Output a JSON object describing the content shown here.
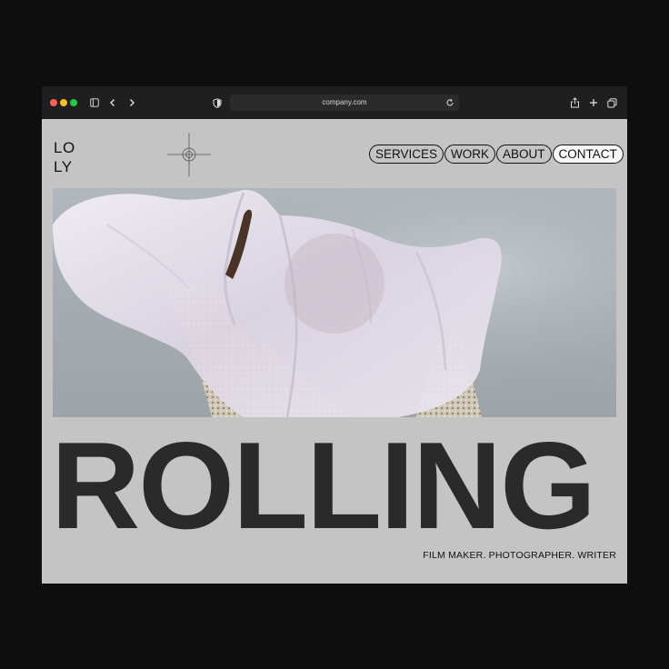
{
  "browser": {
    "address": "company.com",
    "icons": [
      "sidebar-icon",
      "back-icon",
      "forward-icon",
      "shield-icon",
      "reload-icon",
      "share-icon",
      "new-tab-icon",
      "tabs-overview-icon"
    ]
  },
  "site": {
    "logo_line1": "LO",
    "logo_line2": "LY",
    "nav": [
      {
        "label": "SERVICES"
      },
      {
        "label": "WORK"
      },
      {
        "label": "ABOUT"
      },
      {
        "label": "CONTACT"
      }
    ],
    "active_nav": "CONTACT",
    "headline": "ROLLING",
    "tagline": "FILM MAKER. PHOTOGRAPHER. WRITER"
  },
  "colors": {
    "page_bg": "#c4c4c4",
    "text": "#2a2a2a",
    "chrome": "#1f1f1f"
  }
}
